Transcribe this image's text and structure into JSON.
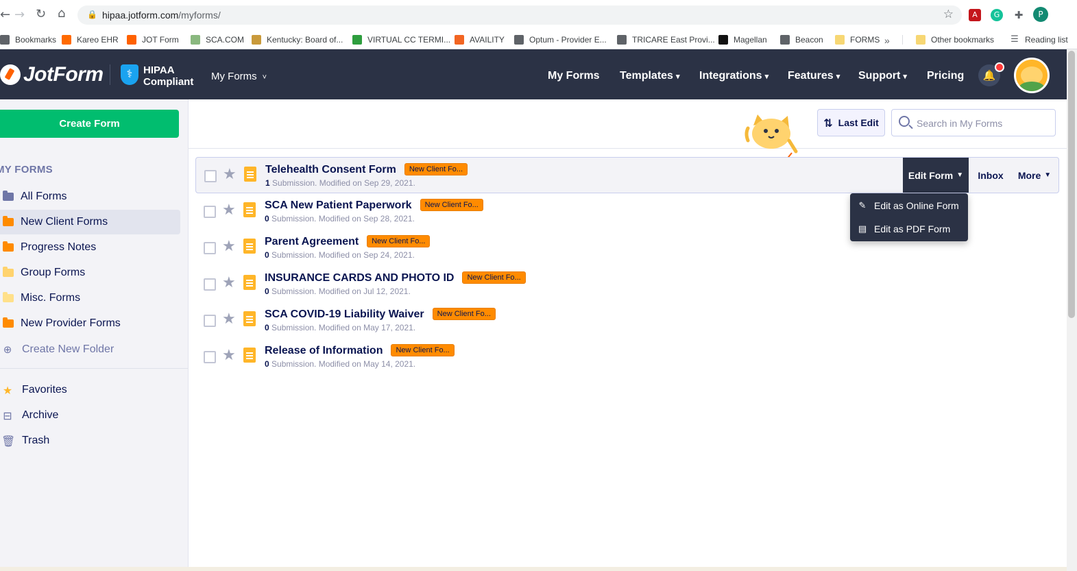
{
  "browser": {
    "url_host": "hipaa.jotform.com",
    "url_path": "/myforms/",
    "profile_initial": "P",
    "bookmarks": [
      {
        "label": "Bookmarks",
        "icon": "bookmark-icon",
        "color": "#5f6368"
      },
      {
        "label": "Kareo EHR",
        "icon": "kareo-icon",
        "color": "#ff6a00"
      },
      {
        "label": "JOT Form",
        "icon": "jotform-icon",
        "color": "#ff6100"
      },
      {
        "label": "SCA.COM",
        "icon": "sca-icon",
        "color": "#8ab87f"
      },
      {
        "label": "Kentucky: Board of...",
        "icon": "kentucky-icon",
        "color": "#c99a3b"
      },
      {
        "label": "VIRTUAL CC TERMI...",
        "icon": "clover-icon",
        "color": "#2e9e3e"
      },
      {
        "label": "AVAILITY",
        "icon": "availity-icon",
        "color": "#f26522"
      },
      {
        "label": "Optum - Provider E...",
        "icon": "globe-icon",
        "color": "#5f6368"
      },
      {
        "label": "TRICARE East Provi...",
        "icon": "globe-icon",
        "color": "#5f6368"
      },
      {
        "label": "Magellan",
        "icon": "magellan-icon",
        "color": "#111111"
      },
      {
        "label": "Beacon",
        "icon": "globe-icon",
        "color": "#5f6368"
      },
      {
        "label": "FORMS",
        "icon": "folder-icon",
        "color": "#f7d774"
      }
    ],
    "overflow": "»",
    "other_bookmarks": "Other bookmarks",
    "reading_list": "Reading list"
  },
  "header": {
    "logo": "JotForm",
    "hipaa_line1": "HIPAA",
    "hipaa_line2": "Compliant",
    "myforms_dropdown": "My Forms",
    "nav": [
      {
        "label": "My Forms",
        "caret": ""
      },
      {
        "label": "Templates",
        "caret": "▾"
      },
      {
        "label": "Integrations",
        "caret": "▾"
      },
      {
        "label": "Features",
        "caret": "▾"
      },
      {
        "label": "Support",
        "caret": "▾"
      },
      {
        "label": "Pricing",
        "caret": ""
      }
    ]
  },
  "sidebar": {
    "create_form": "Create Form",
    "heading": "MY FORMS",
    "folders": [
      {
        "label": "All Forms",
        "color": "#6f76a7",
        "active": false
      },
      {
        "label": "New Client Forms",
        "color": "#ff8b00",
        "active": true
      },
      {
        "label": "Progress Notes",
        "color": "#ff8b00",
        "active": false
      },
      {
        "label": "Group Forms",
        "color": "#ffd36e",
        "active": false
      },
      {
        "label": "Misc. Forms",
        "color": "#ffe08a",
        "active": false
      },
      {
        "label": "New Provider Forms",
        "color": "#ff8b00",
        "active": false
      }
    ],
    "create_folder": "Create New Folder",
    "extras": [
      {
        "label": "Favorites",
        "icon": "star-icon"
      },
      {
        "label": "Archive",
        "icon": "archive-icon"
      },
      {
        "label": "Trash",
        "icon": "trash-icon"
      }
    ]
  },
  "toolbar": {
    "sort_label": "Last Edit",
    "search_placeholder": "Search in My Forms"
  },
  "forms": [
    {
      "title": "Telehealth Consent Form",
      "tag": "New Client Fo...",
      "count": "1",
      "meta": " Submission. Modified on Sep 29, 2021."
    },
    {
      "title": "SCA New Patient Paperwork",
      "tag": "New Client Fo...",
      "count": "0",
      "meta": " Submission. Modified on Sep 28, 2021."
    },
    {
      "title": "Parent Agreement",
      "tag": "New Client Fo...",
      "count": "0",
      "meta": " Submission. Modified on Sep 24, 2021."
    },
    {
      "title": "INSURANCE CARDS AND PHOTO ID",
      "tag": "New Client Fo...",
      "count": "0",
      "meta": " Submission. Modified on Jul 12, 2021."
    },
    {
      "title": "SCA COVID-19 Liability Waiver",
      "tag": "New Client Fo...",
      "count": "0",
      "meta": " Submission. Modified on May 17, 2021."
    },
    {
      "title": "Release of Information",
      "tag": "New Client Fo...",
      "count": "0",
      "meta": " Submission. Modified on May 14, 2021."
    }
  ],
  "row_actions": {
    "edit_form": "Edit Form",
    "inbox": "Inbox",
    "more": "More"
  },
  "edit_menu": {
    "online": "Edit as Online Form",
    "pdf": "Edit as PDF Form"
  },
  "colors": {
    "header_bg": "#2b3245",
    "create_btn": "#01bd6f",
    "tag_bg": "#ff8b00",
    "doc_icon": "#ffb629"
  }
}
